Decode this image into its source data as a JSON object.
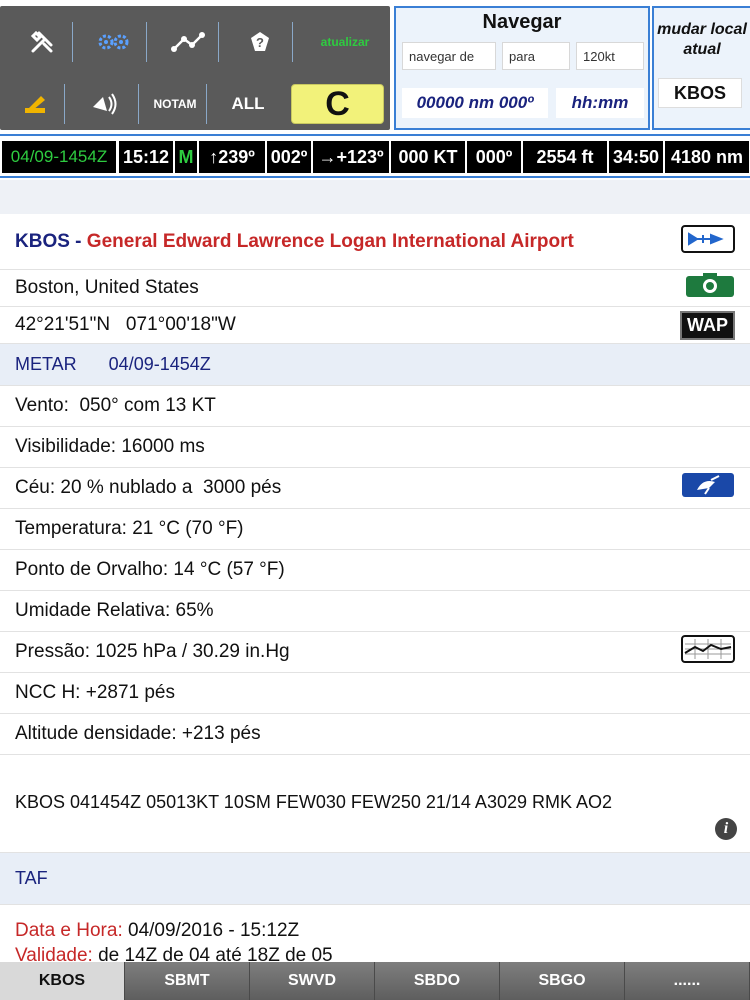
{
  "toolbar": {
    "update_label": "atualizar",
    "notam_label": "NOTAM",
    "all_label": "ALL",
    "c_label": "C"
  },
  "navigate": {
    "title": "Navegar",
    "from_placeholder": "navegar de",
    "to_placeholder": "para",
    "speed": "120kt",
    "distance_bearing": "00000 nm 000º",
    "time": "hh:mm"
  },
  "change_location": {
    "title": "mudar local atual",
    "code": "KBOS"
  },
  "status": {
    "datetime": "04/09-1454Z",
    "time": "15:12",
    "mode": "M",
    "heading": "239º",
    "course": "002º",
    "relative": "+123º",
    "speed": "000 KT",
    "track": "000º",
    "altitude": "2554 ft",
    "ete": "34:50",
    "distance": "4180 nm"
  },
  "airport": {
    "code": "KBOS",
    "separator": " - ",
    "name": "General Edward Lawrence Logan International Airport",
    "location": "Boston, United States",
    "coordinates": "42°21'51\"N   071°00'18\"W",
    "wap_label": "WAP"
  },
  "metar": {
    "label": "METAR",
    "datetime": "04/09-1454Z",
    "rows": [
      "Vento:  050° com 13 KT",
      "Visibilidade: 16000 ms",
      "Céu: 20 % nublado a  3000 pés",
      "Temperatura: 21 °C (70 °F)",
      "Ponto de Orvalho: 14 °C (57 °F)",
      "Umidade Relativa: 65%",
      "Pressão: 1025 hPa / 30.29 in.Hg",
      "NCC H: +2871 pés",
      "Altitude densidade: +213 pés"
    ],
    "raw": "KBOS 041454Z 05013KT 10SM FEW030 FEW250 21/14 A3029 RMK AO2"
  },
  "taf": {
    "label": "TAF",
    "datetime_label": "Data e Hora:",
    "datetime_value": " 04/09/2016 - 15:12Z",
    "validity_label": "Validade:",
    "validity_value": " de 14Z de 04 até 18Z de 05"
  },
  "tabs": [
    "KBOS",
    "SBMT",
    "SWVD",
    "SBDO",
    "SBGO",
    "......"
  ],
  "colors": {
    "accent": "#3a7fd5",
    "airport_name": "#c62828",
    "code_blue": "#1a237e",
    "update_green": "#2ecc40",
    "status_mode_green": "#2ecc40"
  }
}
